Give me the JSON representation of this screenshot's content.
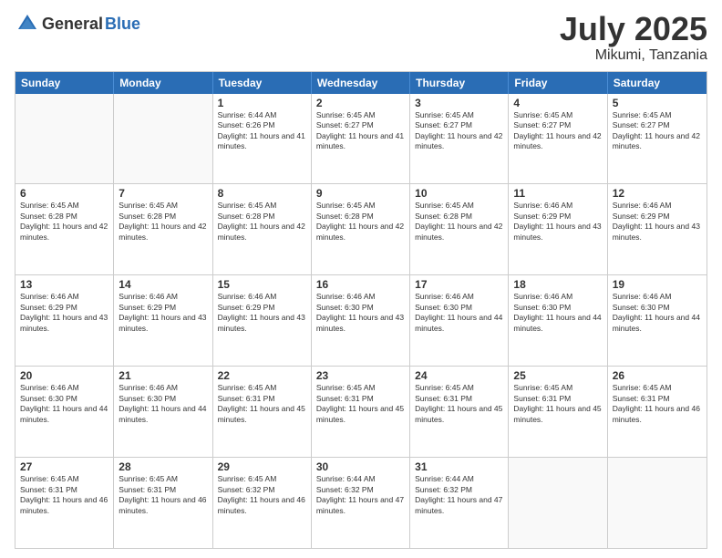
{
  "header": {
    "logo_general": "General",
    "logo_blue": "Blue",
    "month": "July 2025",
    "location": "Mikumi, Tanzania"
  },
  "weekdays": [
    "Sunday",
    "Monday",
    "Tuesday",
    "Wednesday",
    "Thursday",
    "Friday",
    "Saturday"
  ],
  "rows": [
    [
      {
        "day": "",
        "text": ""
      },
      {
        "day": "",
        "text": ""
      },
      {
        "day": "1",
        "text": "Sunrise: 6:44 AM\nSunset: 6:26 PM\nDaylight: 11 hours and 41 minutes."
      },
      {
        "day": "2",
        "text": "Sunrise: 6:45 AM\nSunset: 6:27 PM\nDaylight: 11 hours and 41 minutes."
      },
      {
        "day": "3",
        "text": "Sunrise: 6:45 AM\nSunset: 6:27 PM\nDaylight: 11 hours and 42 minutes."
      },
      {
        "day": "4",
        "text": "Sunrise: 6:45 AM\nSunset: 6:27 PM\nDaylight: 11 hours and 42 minutes."
      },
      {
        "day": "5",
        "text": "Sunrise: 6:45 AM\nSunset: 6:27 PM\nDaylight: 11 hours and 42 minutes."
      }
    ],
    [
      {
        "day": "6",
        "text": "Sunrise: 6:45 AM\nSunset: 6:28 PM\nDaylight: 11 hours and 42 minutes."
      },
      {
        "day": "7",
        "text": "Sunrise: 6:45 AM\nSunset: 6:28 PM\nDaylight: 11 hours and 42 minutes."
      },
      {
        "day": "8",
        "text": "Sunrise: 6:45 AM\nSunset: 6:28 PM\nDaylight: 11 hours and 42 minutes."
      },
      {
        "day": "9",
        "text": "Sunrise: 6:45 AM\nSunset: 6:28 PM\nDaylight: 11 hours and 42 minutes."
      },
      {
        "day": "10",
        "text": "Sunrise: 6:45 AM\nSunset: 6:28 PM\nDaylight: 11 hours and 42 minutes."
      },
      {
        "day": "11",
        "text": "Sunrise: 6:46 AM\nSunset: 6:29 PM\nDaylight: 11 hours and 43 minutes."
      },
      {
        "day": "12",
        "text": "Sunrise: 6:46 AM\nSunset: 6:29 PM\nDaylight: 11 hours and 43 minutes."
      }
    ],
    [
      {
        "day": "13",
        "text": "Sunrise: 6:46 AM\nSunset: 6:29 PM\nDaylight: 11 hours and 43 minutes."
      },
      {
        "day": "14",
        "text": "Sunrise: 6:46 AM\nSunset: 6:29 PM\nDaylight: 11 hours and 43 minutes."
      },
      {
        "day": "15",
        "text": "Sunrise: 6:46 AM\nSunset: 6:29 PM\nDaylight: 11 hours and 43 minutes."
      },
      {
        "day": "16",
        "text": "Sunrise: 6:46 AM\nSunset: 6:30 PM\nDaylight: 11 hours and 43 minutes."
      },
      {
        "day": "17",
        "text": "Sunrise: 6:46 AM\nSunset: 6:30 PM\nDaylight: 11 hours and 44 minutes."
      },
      {
        "day": "18",
        "text": "Sunrise: 6:46 AM\nSunset: 6:30 PM\nDaylight: 11 hours and 44 minutes."
      },
      {
        "day": "19",
        "text": "Sunrise: 6:46 AM\nSunset: 6:30 PM\nDaylight: 11 hours and 44 minutes."
      }
    ],
    [
      {
        "day": "20",
        "text": "Sunrise: 6:46 AM\nSunset: 6:30 PM\nDaylight: 11 hours and 44 minutes."
      },
      {
        "day": "21",
        "text": "Sunrise: 6:46 AM\nSunset: 6:30 PM\nDaylight: 11 hours and 44 minutes."
      },
      {
        "day": "22",
        "text": "Sunrise: 6:45 AM\nSunset: 6:31 PM\nDaylight: 11 hours and 45 minutes."
      },
      {
        "day": "23",
        "text": "Sunrise: 6:45 AM\nSunset: 6:31 PM\nDaylight: 11 hours and 45 minutes."
      },
      {
        "day": "24",
        "text": "Sunrise: 6:45 AM\nSunset: 6:31 PM\nDaylight: 11 hours and 45 minutes."
      },
      {
        "day": "25",
        "text": "Sunrise: 6:45 AM\nSunset: 6:31 PM\nDaylight: 11 hours and 45 minutes."
      },
      {
        "day": "26",
        "text": "Sunrise: 6:45 AM\nSunset: 6:31 PM\nDaylight: 11 hours and 46 minutes."
      }
    ],
    [
      {
        "day": "27",
        "text": "Sunrise: 6:45 AM\nSunset: 6:31 PM\nDaylight: 11 hours and 46 minutes."
      },
      {
        "day": "28",
        "text": "Sunrise: 6:45 AM\nSunset: 6:31 PM\nDaylight: 11 hours and 46 minutes."
      },
      {
        "day": "29",
        "text": "Sunrise: 6:45 AM\nSunset: 6:32 PM\nDaylight: 11 hours and 46 minutes."
      },
      {
        "day": "30",
        "text": "Sunrise: 6:44 AM\nSunset: 6:32 PM\nDaylight: 11 hours and 47 minutes."
      },
      {
        "day": "31",
        "text": "Sunrise: 6:44 AM\nSunset: 6:32 PM\nDaylight: 11 hours and 47 minutes."
      },
      {
        "day": "",
        "text": ""
      },
      {
        "day": "",
        "text": ""
      }
    ]
  ]
}
